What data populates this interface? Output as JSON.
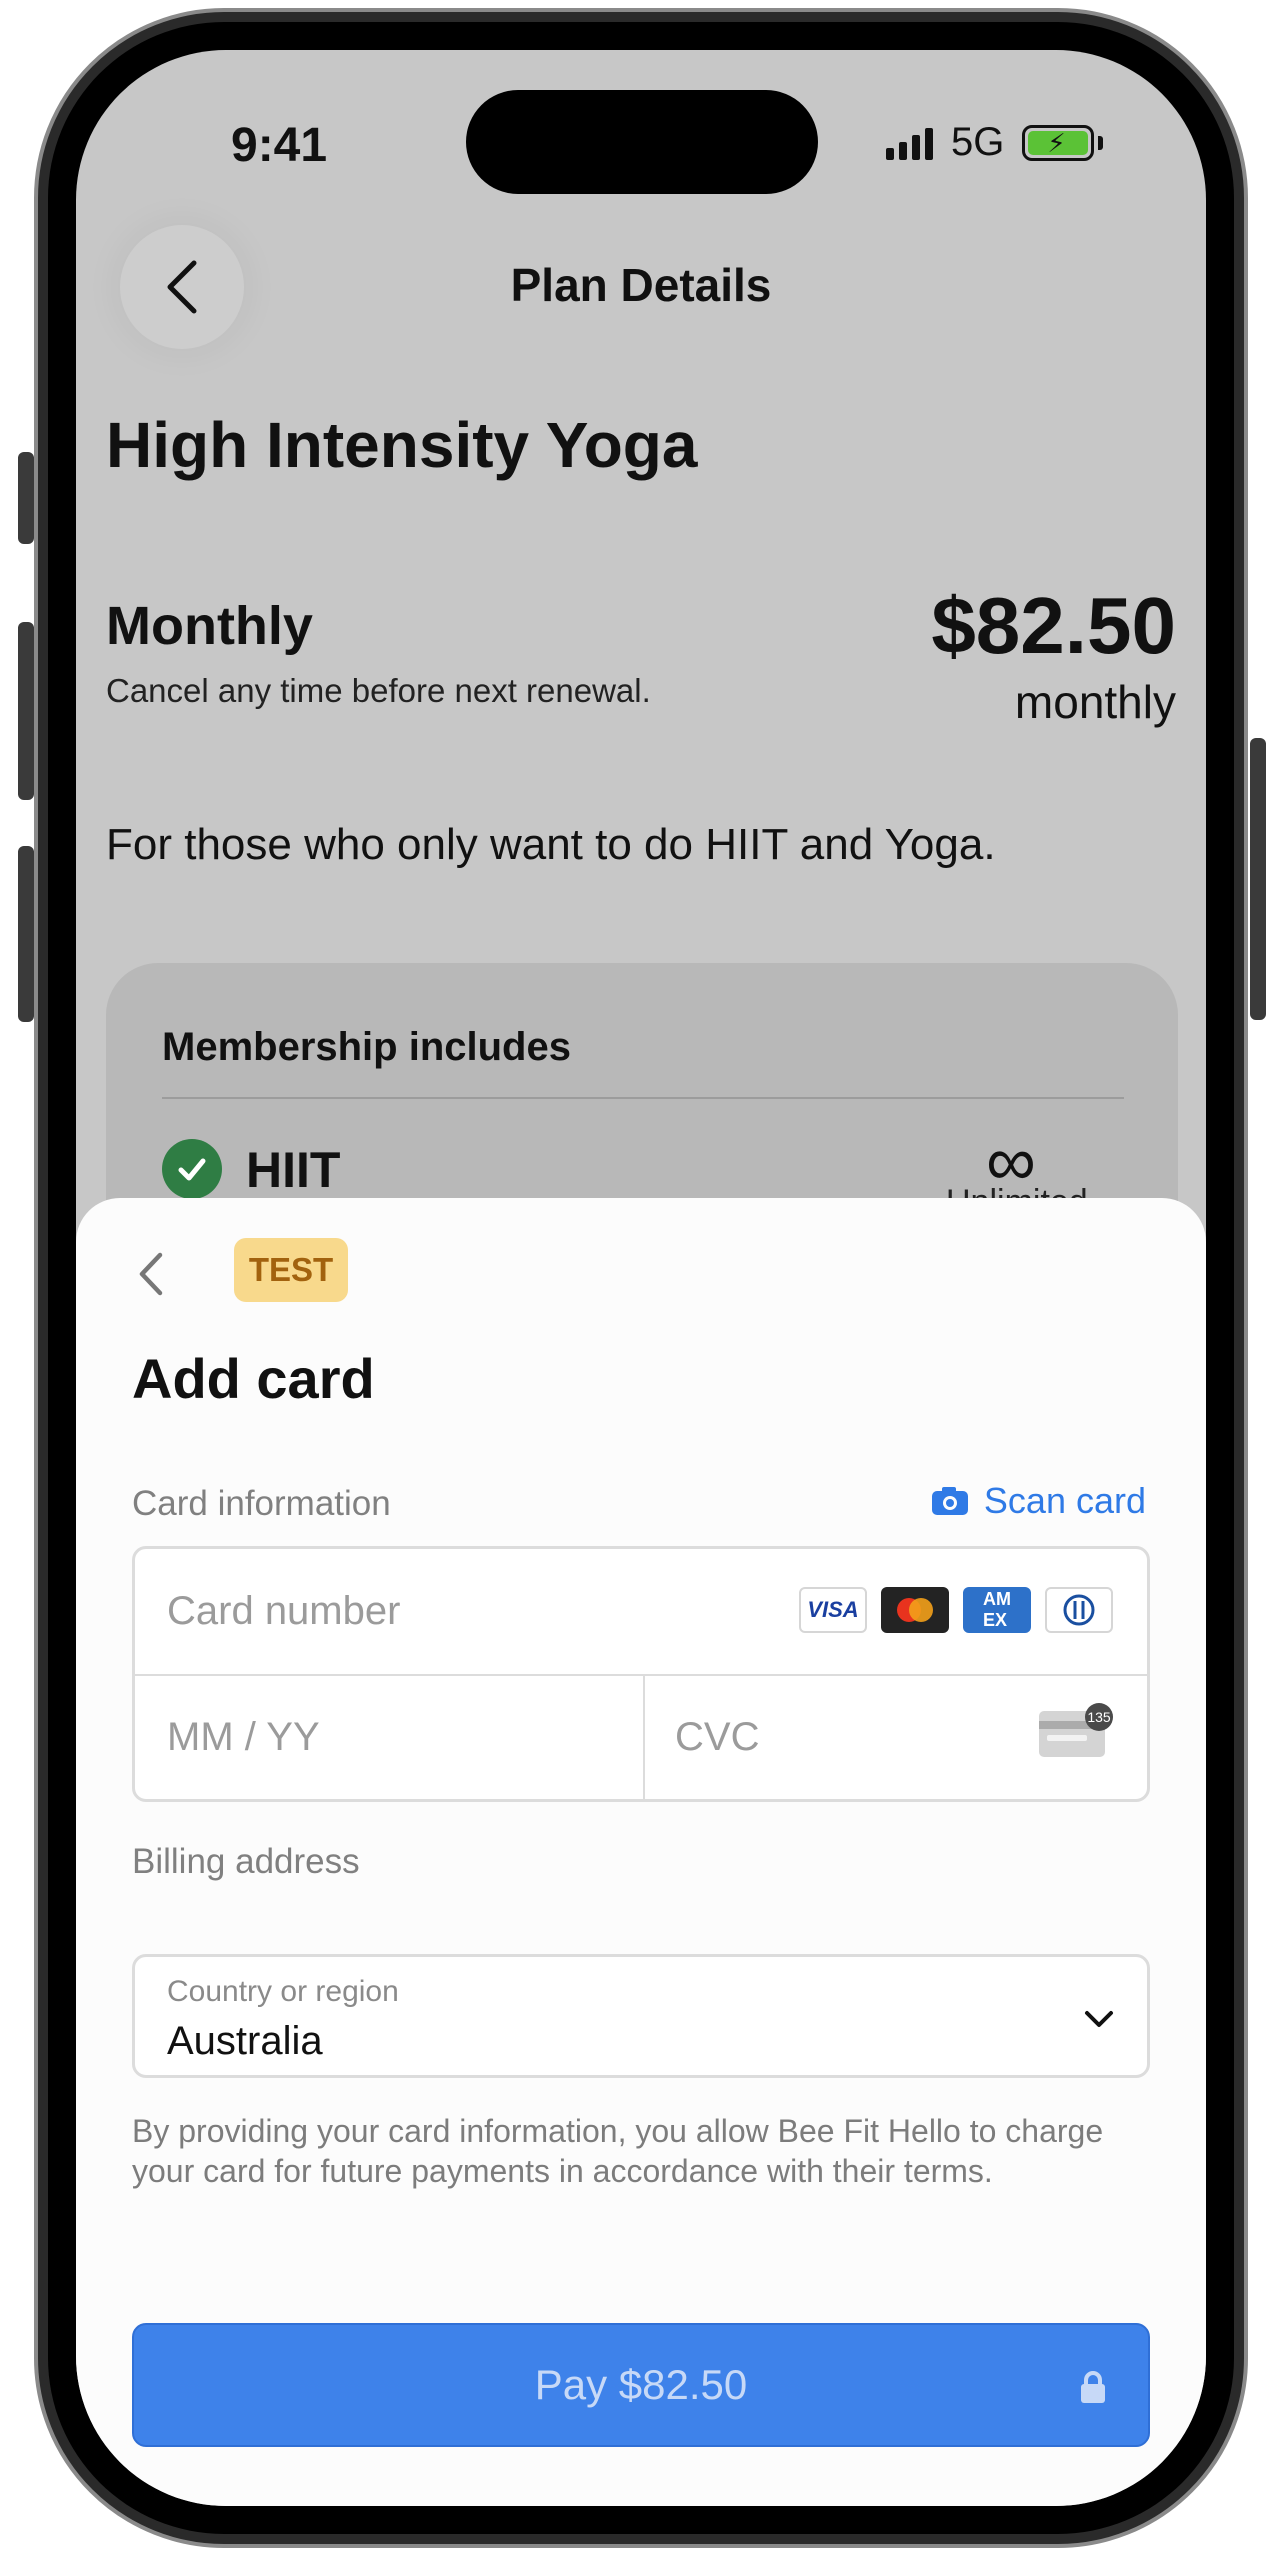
{
  "status_bar": {
    "time": "9:41",
    "network": "5G"
  },
  "header": {
    "title": "Plan Details",
    "back_icon": "chevron-left-icon"
  },
  "plan": {
    "name": "High Intensity Yoga",
    "billing_type": "Monthly",
    "billing_note": "Cancel any time before next renewal.",
    "price": "$82.50",
    "price_period": "monthly",
    "description": "For those who only want to do HIIT and Yoga."
  },
  "membership": {
    "title": "Membership includes",
    "features": [
      {
        "label": "HIIT",
        "icon": "infinity-icon",
        "sub": "Unlimited"
      }
    ]
  },
  "sheet": {
    "badge": "TEST",
    "title": "Add card",
    "card_info_label": "Card information",
    "scan_card_label": "Scan card",
    "card_number_placeholder": "Card number",
    "expiry_placeholder": "MM / YY",
    "cvc_placeholder": "CVC",
    "card_brands": [
      "VISA",
      "Mastercard",
      "AMEX",
      "Diners"
    ],
    "cvc_hint": "135",
    "billing_label": "Billing address",
    "country_label": "Country or region",
    "country_value": "Australia",
    "legal_text": "By providing your card information, you allow Bee Fit Hello to charge your card for future payments in accordance with their terms.",
    "pay_label": "Pay $82.50"
  },
  "colors": {
    "accent": "#3e82ea",
    "link": "#2f7ae6",
    "badge_bg": "#f8d98c",
    "badge_text": "#a2620e",
    "check_green": "#2f7d44",
    "overlay_bg": "#c7c7c7"
  }
}
